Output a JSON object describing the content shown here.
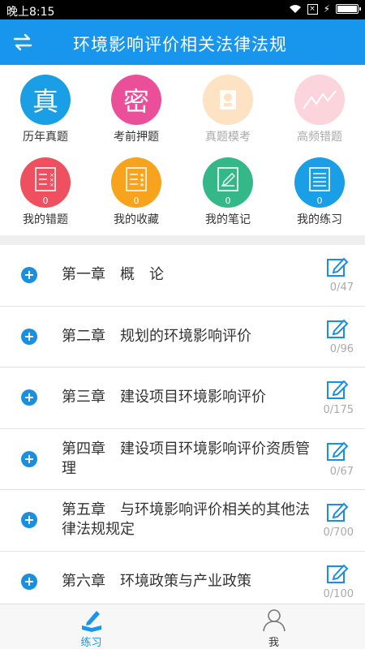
{
  "status_bar": {
    "time": "晚上8:15",
    "battery_level": 1.0
  },
  "app_bar": {
    "title": "环境影响评价相关法律法规",
    "switch_icon": "swap-arrows-icon"
  },
  "grid": {
    "items": [
      {
        "label": "历年真题",
        "glyph": "真",
        "color": "#1a9ee6",
        "enabled": true
      },
      {
        "label": "考前押题",
        "glyph": "密",
        "color": "#ec4f9a",
        "enabled": true
      },
      {
        "label": "真题模考",
        "icon": "exam-robot-icon",
        "color": "#fde3c4",
        "enabled": false
      },
      {
        "label": "高频错题",
        "icon": "trend-chart-icon",
        "color": "#fbd4dc",
        "enabled": false
      },
      {
        "label": "我的错题",
        "icon": "wrong-list-icon",
        "color": "#ef5060",
        "count": "0",
        "enabled": true
      },
      {
        "label": "我的收藏",
        "icon": "star-list-icon",
        "color": "#f7a31e",
        "count": "0",
        "enabled": true
      },
      {
        "label": "我的笔记",
        "icon": "note-edit-icon",
        "color": "#34b88a",
        "count": "0",
        "enabled": true
      },
      {
        "label": "我的练习",
        "icon": "practice-list-icon",
        "color": "#1a9ee6",
        "count": "0",
        "enabled": true
      }
    ]
  },
  "chapters": [
    {
      "title": "第一章　概　论",
      "progress": "0/47"
    },
    {
      "title": "第二章　规划的环境影响评价",
      "progress": "0/96"
    },
    {
      "title": "第三章　建设项目环境影响评价",
      "progress": "0/175"
    },
    {
      "title": "第四章　建设项目环境影响评价资质管理",
      "progress": "0/67"
    },
    {
      "title": "第五章　与环境影响评价相关的其他法律法规规定",
      "progress": "0/700"
    },
    {
      "title": "第六章　环境政策与产业政策",
      "progress": "0/100"
    }
  ],
  "tab_bar": {
    "tabs": [
      {
        "label": "练习",
        "icon": "pen-book-icon",
        "active": true
      },
      {
        "label": "我",
        "icon": "user-icon",
        "active": false
      }
    ]
  },
  "colors": {
    "accent": "#1896ee",
    "plus": "#1a8fe0"
  }
}
